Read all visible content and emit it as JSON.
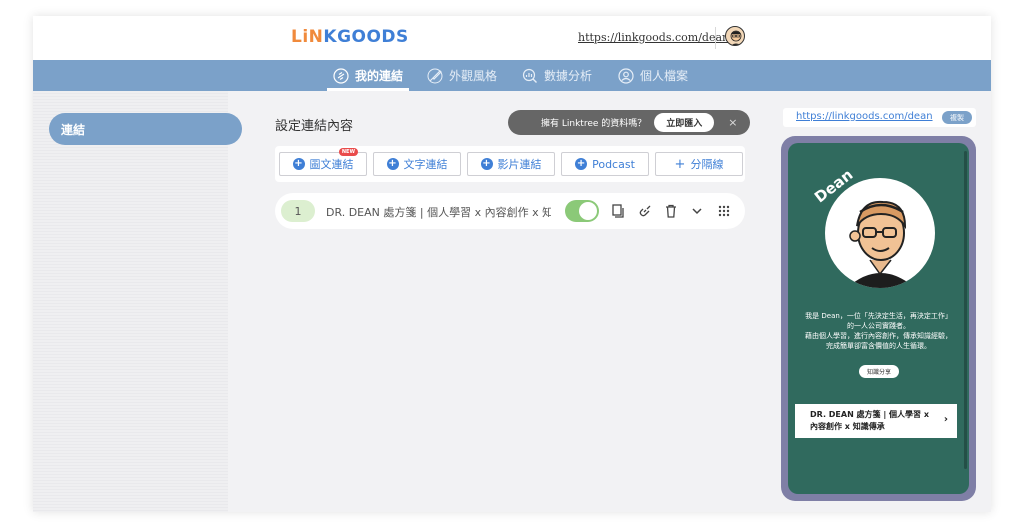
{
  "brand": {
    "logo_part1": "LiN",
    "logo_part2": "KGOODS"
  },
  "header": {
    "url": "https://linkgoods.com/dean"
  },
  "nav": {
    "items": [
      {
        "label": "我的連結",
        "icon": "link-icon",
        "active": true
      },
      {
        "label": "外觀風格",
        "icon": "brush-icon",
        "active": false
      },
      {
        "label": "數據分析",
        "icon": "analytics-icon",
        "active": false
      },
      {
        "label": "個人檔案",
        "icon": "user-icon",
        "active": false
      }
    ]
  },
  "sidebar": {
    "items": [
      {
        "label": "連結",
        "active": true
      }
    ]
  },
  "main": {
    "title": "設定連結內容",
    "import": {
      "text": "擁有 Linktree 的資料嗎？",
      "button": "立即匯入",
      "close": "×"
    },
    "add_buttons": [
      {
        "label": "圖文連結",
        "badge": "NEW",
        "prefix": "+"
      },
      {
        "label": "文字連結",
        "prefix": "+"
      },
      {
        "label": "影片連結",
        "prefix": "+"
      },
      {
        "label": "Podcast",
        "prefix": "+"
      },
      {
        "label": "分隔線",
        "prefix": "+"
      }
    ],
    "links": [
      {
        "index": "1",
        "title": "DR. DEAN 處方箋 | 個人學習 x 內容創作 x 知…",
        "enabled": true
      }
    ]
  },
  "preview": {
    "url": "https://linkgoods.com/dean",
    "copy_label": "複製",
    "profile_name": "Dean",
    "bio_lines": [
      "我是 Dean，一位「先決定生活，再決定工作」",
      "的一人公司實踐者。",
      "藉由個人學習，進行內容創作，傳承知識經驗，",
      "完成簡單卻富含價值的人生循環。"
    ],
    "tag_button": "知識分享",
    "card": {
      "line1": "DR. DEAN 處方箋 | 個人學習 x",
      "line2": "內容創作 x 知識傳承",
      "chevron": "›"
    }
  },
  "colors": {
    "accent": "#7ba1c9",
    "brand_orange": "#f08a3c",
    "brand_blue": "#3f7fd6",
    "toggle_on": "#8bc978",
    "phone_bg": "#306a5e"
  }
}
